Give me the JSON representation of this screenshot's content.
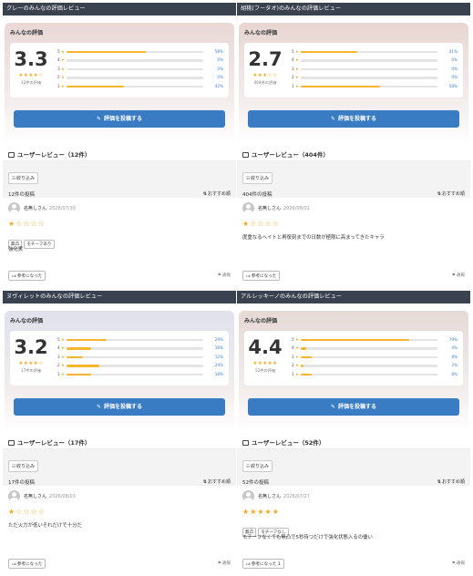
{
  "panels": [
    {
      "title": "クレーのみんなの評価レビュー",
      "card_label": "みんなの評価",
      "score": "3.3",
      "stars": "★★★★☆",
      "rating_count": "12件の評価",
      "bars": [
        {
          "label": "5",
          "percent": 58,
          "pct_text": "58%"
        },
        {
          "label": "4",
          "percent": 0,
          "pct_text": "0%"
        },
        {
          "label": "3",
          "percent": 0,
          "pct_text": "0%"
        },
        {
          "label": "2",
          "percent": 0,
          "pct_text": "0%"
        },
        {
          "label": "1",
          "percent": 42,
          "pct_text": "42%"
        }
      ],
      "post_button": "評価を投稿する",
      "section_title": "ユーザーレビュー（12件）",
      "filter_label": "絞り込み",
      "post_count": "12件の投稿",
      "sort_label": "おすすめ順",
      "reviewer": "名無しさん",
      "date": "2026/07/30",
      "review_stars": "★☆☆☆☆",
      "tags": [
        "無凸",
        "モチーフあり"
      ],
      "review_text": "強化実",
      "helpful_label": "参考になった",
      "report_label": "通報",
      "bg": "#e9d8d6"
    },
    {
      "title": "胡桃(フータオ)のみんなの評価レビュー",
      "card_label": "みんなの評価",
      "score": "2.7",
      "stars": "★★★☆☆",
      "rating_count": "404件の評価",
      "bars": [
        {
          "label": "5",
          "percent": 41,
          "pct_text": "41%"
        },
        {
          "label": "4",
          "percent": 0,
          "pct_text": "0%"
        },
        {
          "label": "3",
          "percent": 0,
          "pct_text": "0%"
        },
        {
          "label": "2",
          "percent": 0,
          "pct_text": "0%"
        },
        {
          "label": "1",
          "percent": 58,
          "pct_text": "58%"
        }
      ],
      "post_button": "評価を投稿する",
      "section_title": "ユーザーレビュー（404件）",
      "filter_label": "絞り込み",
      "post_count": "404件の投稿",
      "sort_label": "おすすめ順",
      "reviewer": "名無しさん",
      "date": "2026/08/01",
      "review_stars": "★☆☆☆☆",
      "tags": [],
      "review_text": "度重なるヘイトと再復刻までの日数が極限に高まってきたキャラ",
      "helpful_label": "参考になった",
      "report_label": "通報",
      "bg": "#e8d6d2"
    },
    {
      "title": "ヌヴィレットのみんなの評価レビュー",
      "card_label": "みんなの評価",
      "score": "3.2",
      "stars": "★★★★☆",
      "rating_count": "17件の評価",
      "bars": [
        {
          "label": "5",
          "percent": 29,
          "pct_text": "29%"
        },
        {
          "label": "4",
          "percent": 18,
          "pct_text": "18%"
        },
        {
          "label": "3",
          "percent": 12,
          "pct_text": "12%"
        },
        {
          "label": "2",
          "percent": 24,
          "pct_text": "24%"
        },
        {
          "label": "1",
          "percent": 18,
          "pct_text": "18%"
        }
      ],
      "post_button": "評価を投稿する",
      "section_title": "ユーザーレビュー（17件）",
      "filter_label": "絞り込み",
      "post_count": "17件の投稿",
      "sort_label": "おすすめ順",
      "reviewer": "名無しさん",
      "date": "2026/08/03",
      "review_stars": "★☆☆☆☆",
      "tags": [],
      "review_text": "ただ火力が低いそれだけで十分だ",
      "helpful_label": "参考になった",
      "report_label": "通報",
      "bg": "#dfe1ec"
    },
    {
      "title": "アルレッキーノのみんなの評価レビュー",
      "card_label": "みんなの評価",
      "score": "4.4",
      "stars": "★★★★★",
      "rating_count": "52件の評価",
      "bars": [
        {
          "label": "5",
          "percent": 79,
          "pct_text": "79%"
        },
        {
          "label": "4",
          "percent": 4,
          "pct_text": "4%"
        },
        {
          "label": "3",
          "percent": 8,
          "pct_text": "8%"
        },
        {
          "label": "2",
          "percent": 2,
          "pct_text": "2%"
        },
        {
          "label": "1",
          "percent": 8,
          "pct_text": "8%"
        }
      ],
      "post_button": "評価を投稿する",
      "section_title": "ユーザーレビュー（52件）",
      "filter_label": "絞り込み",
      "post_count": "52件の投稿",
      "sort_label": "おすすめ順",
      "reviewer": "名無しさん",
      "date": "2026/07/27",
      "review_stars": "★★★★★",
      "tags": [
        "無凸",
        "モチーフなし"
      ],
      "review_text": "モチーフなくても無凸で5秒待つだけで強化状態入るの優い",
      "helpful_label": "参考になった 1",
      "report_label": "通報",
      "bg": "#e6d9d6"
    }
  ],
  "colors": {
    "title_bar": "#3a4250",
    "accent_blue": "#3a7cc4",
    "star": "#f5a623",
    "bar_fill": "#f7b52c",
    "pct_text": "#3b7dd8"
  },
  "icons": {
    "pencil": "pencil-icon",
    "chat": "chat-bubble-icon",
    "filter": "filter-icon",
    "sort": "sort-icon",
    "thumb": "thumbs-up-icon",
    "flag": "flag-icon"
  }
}
